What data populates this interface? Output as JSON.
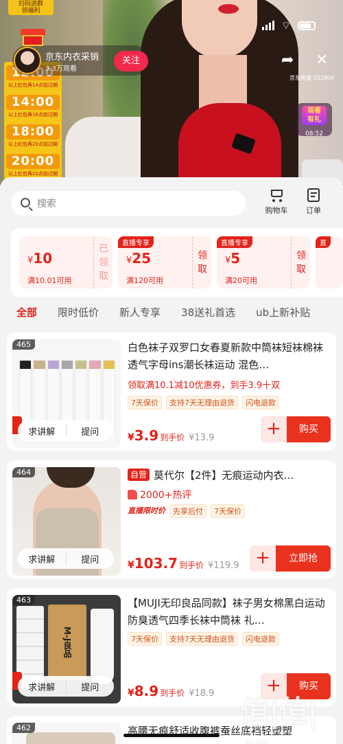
{
  "live": {
    "promo_tag": "扫码进群\n领福利",
    "host_name": "京东内衣采销",
    "host_views": "3.3万观看",
    "follow_label": "关注",
    "room_id": "京东直播 332806",
    "time_slots": [
      {
        "time": "12:00",
        "note": ""
      },
      {
        "time": "14:00",
        "note": "以上红包再14点前过期"
      },
      {
        "time": "18:00",
        "note": "以上红包再16点前过期"
      },
      {
        "time": "20:00",
        "note": "以上红包再20点前过期"
      }
    ],
    "time_last_note": "以上红包再22点前过期",
    "time_top_note": "以上红包再14点前过期",
    "watch_label": "观看\n有礼",
    "watch_time": "08:52"
  },
  "search": {
    "placeholder": "搜索"
  },
  "actions": {
    "cart": "购物车",
    "orders": "订单"
  },
  "coupons": [
    {
      "tag": "",
      "symbol": "¥",
      "amount": "10",
      "condition": "满10.01可用",
      "claim": "已领取",
      "claimed": true
    },
    {
      "tag": "直播专享",
      "symbol": "¥",
      "amount": "25",
      "condition": "满120可用",
      "claim": "领取",
      "claimed": false
    },
    {
      "tag": "直播专享",
      "symbol": "¥",
      "amount": "5",
      "condition": "满20可用",
      "claim": "领取",
      "claimed": false
    },
    {
      "tag": "直",
      "symbol": "",
      "amount": "",
      "condition": "",
      "claim": "",
      "claimed": false
    }
  ],
  "tabs": [
    "全部",
    "限时低价",
    "新人专享",
    "38送礼首选",
    "ub上新补贴"
  ],
  "products": [
    {
      "index": "465",
      "title": "白色袜子双罗口女春夏新款中筒袜短袜棉袜透气字母ins潮长袜运动 混色…",
      "promo": "领取满10.1减10优惠券，到手3.9十双",
      "chips": [
        "7天保价",
        "支持7天无理由退货",
        "闪电退款"
      ],
      "price": "3.9",
      "price_label": "到手价",
      "orig": "¥13.9",
      "button": "购买",
      "explain": "求讲解",
      "ask": "提问"
    },
    {
      "index": "464",
      "self_op": "自营",
      "title": "莫代尔【2件】无痕运动内衣…",
      "review": "2000+热评",
      "chips": [
        "直播限时价",
        "先享后付",
        "7天保价"
      ],
      "price": "103.7",
      "price_label": "到手价",
      "orig": "¥119.9",
      "button": "立即抢",
      "explain": "求讲解",
      "ask": "提问"
    },
    {
      "index": "463",
      "title": "【MUJI无印良品同款】袜子男女棉黑白运动防臭透气四季长袜中筒袜 礼…",
      "chips": [
        "7天保价",
        "支持7天无理由退货",
        "闪电退款"
      ],
      "price": "8.9",
      "price_label": "到手价",
      "orig": "¥18.9",
      "button": "购买",
      "explain": "求讲解",
      "ask": "提问",
      "box_text": "M-J良品"
    },
    {
      "index": "462",
      "title": "高腰无痕舒适收腹裤蚕丝底裆轻塑塑"
    }
  ],
  "watermark": "值|值|值"
}
